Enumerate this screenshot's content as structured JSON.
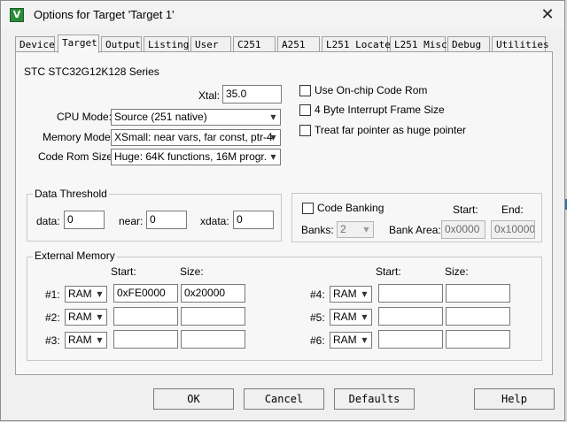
{
  "window": {
    "title": "Options for Target 'Target 1'",
    "close": "✕"
  },
  "tabs": [
    {
      "label": "Device"
    },
    {
      "label": "Target"
    },
    {
      "label": "Output"
    },
    {
      "label": "Listing"
    },
    {
      "label": "User"
    },
    {
      "label": "C251"
    },
    {
      "label": "A251"
    },
    {
      "label": "L251 Locate"
    },
    {
      "label": "L251 Misc"
    },
    {
      "label": "Debug"
    },
    {
      "label": "Utilities"
    }
  ],
  "target": {
    "device_name": "STC STC32G12K128 Series",
    "xtal": {
      "label": "Xtal:",
      "value": "35.0"
    },
    "cpu_mode": {
      "label": "CPU Mode:",
      "value": "Source (251 native)"
    },
    "memory_model": {
      "label": "Memory Model:",
      "value": "XSmall: near vars, far const, ptr-4"
    },
    "code_rom_size": {
      "label": "Code Rom Size:",
      "value": "Huge: 64K functions, 16M progr."
    },
    "options": [
      {
        "label": "Use On-chip Code Rom",
        "checked": false
      },
      {
        "label": "4 Byte Interrupt Frame Size",
        "checked": false
      },
      {
        "label": "Treat far pointer as huge pointer",
        "checked": false
      }
    ]
  },
  "data_threshold": {
    "title": "Data Threshold",
    "data": {
      "label": "data:",
      "value": "0"
    },
    "near": {
      "label": "near:",
      "value": "0"
    },
    "xdata": {
      "label": "xdata:",
      "value": "0"
    }
  },
  "code_banking": {
    "label": "Code Banking",
    "checked": false,
    "banks_label": "Banks:",
    "banks_value": "2",
    "bank_area_label": "Bank Area:",
    "start_label": "Start:",
    "end_label": "End:",
    "start_value": "0x0000",
    "end_value": "0x10000"
  },
  "external_memory": {
    "title": "External Memory",
    "start_label": "Start:",
    "size_label": "Size:",
    "rows": [
      {
        "label": "#1:",
        "type": "RAM",
        "start": "0xFE0000",
        "size": "0x20000"
      },
      {
        "label": "#2:",
        "type": "RAM",
        "start": "",
        "size": ""
      },
      {
        "label": "#3:",
        "type": "RAM",
        "start": "",
        "size": ""
      },
      {
        "label": "#4:",
        "type": "RAM",
        "start": "",
        "size": ""
      },
      {
        "label": "#5:",
        "type": "RAM",
        "start": "",
        "size": ""
      },
      {
        "label": "#6:",
        "type": "RAM",
        "start": "",
        "size": ""
      }
    ]
  },
  "buttons": {
    "ok": "OK",
    "cancel": "Cancel",
    "defaults": "Defaults",
    "help": "Help"
  },
  "colors": {
    "dialog_bg": "#f0f0f0",
    "panel_bg": "#f7f7f7",
    "app_icon": "#2a8c3a"
  }
}
